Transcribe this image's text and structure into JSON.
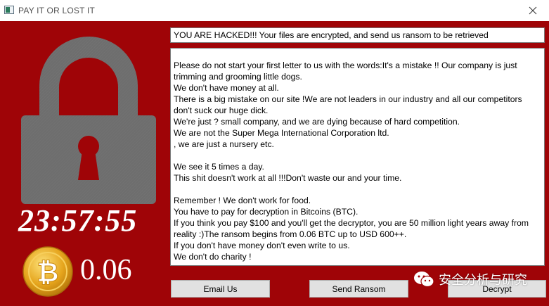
{
  "window": {
    "title": "PAY IT OR LOST IT",
    "close_glyph": "✕"
  },
  "countdown": "23:57:55",
  "bitcoin": {
    "icon": "bitcoin-coin-icon",
    "symbol": "₿",
    "amount": "0.06"
  },
  "headline": "YOU ARE HACKED!!! Your files are encrypted, and send us ransom to be retrieved",
  "message": {
    "lines": [
      "Please do not start your first letter to us with the words:It's a mistake !! Our company is just trimming and grooming little dogs.",
      " We don't have money at all.",
      "There is a big mistake on our site !We are not leaders in our industry and all our competitors don't suck our huge dick.",
      "We're just ? small company, and we are dying because of hard competition.",
      "We are not the Super Mega International Corporation ltd.",
      ", we are just a nursery etc.",
      "",
      "We see it 5 times a day.",
      " This shit doesn't work at all !!!Don't waste our and your time.",
      "",
      "Remember ! We don't work for food.",
      "You have to pay for decryption in Bitcoins (BTC).",
      "If you think you pay $100 and you'll get the decryptor, you are 50 million light years away from reality :)The ransom begins from 0.06 BTC up to USD 600++.",
      "If you don't have money don't even write to us.",
      "We don't do charity !"
    ]
  },
  "buttons": {
    "email": "Email Us",
    "send": "Send Ransom",
    "decrypt": "Decrypt"
  },
  "watermark": {
    "icon": "wechat-icon",
    "text": "安全分析与研究"
  },
  "colors": {
    "background_red": "#9f0407",
    "lock_gray": "#6e6e6e",
    "keyhole_red": "#9f0407",
    "coin_gold": "#e5a41c"
  }
}
